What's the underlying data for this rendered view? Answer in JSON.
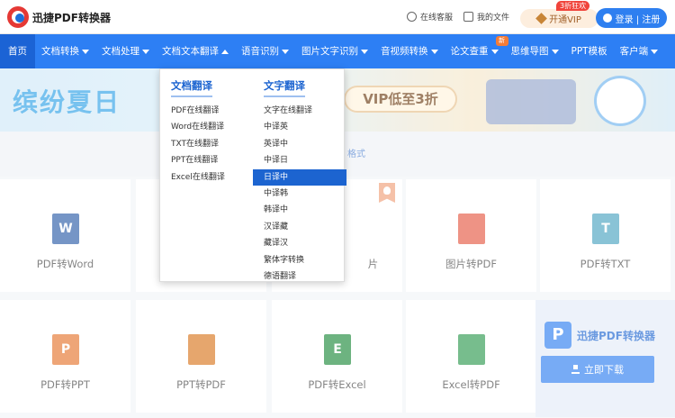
{
  "header": {
    "brand": "迅捷PDF转换器",
    "service": "在线客服",
    "my_files": "我的文件",
    "vip_button": "开通VIP",
    "vip_tag": "3折狂欢",
    "login": "登录 | 注册"
  },
  "nav": {
    "items": [
      {
        "label": "首页"
      },
      {
        "label": "文档转换"
      },
      {
        "label": "文档处理"
      },
      {
        "label": "文档文本翻译"
      },
      {
        "label": "语音识别"
      },
      {
        "label": "图片文字识别"
      },
      {
        "label": "音视频转换"
      },
      {
        "label": "论文查重"
      },
      {
        "label": "思维导图"
      },
      {
        "label": "PPT模板"
      },
      {
        "label": "客户端"
      }
    ],
    "new_badge": "新"
  },
  "banner": {
    "title": "缤纷夏日",
    "vip": "VIP低至3折"
  },
  "strip": {
    "text": "格式"
  },
  "dropdown": {
    "col1_title": "文档翻译",
    "col1_items": [
      "PDF在线翻译",
      "Word在线翻译",
      "TXT在线翻译",
      "PPT在线翻译",
      "Excel在线翻译"
    ],
    "col2_title": "文字翻译",
    "col2_items": [
      "文字在线翻译",
      "中译英",
      "英译中",
      "中译日",
      "日译中",
      "中译韩",
      "韩译中",
      "汉译藏",
      "藏译汉",
      "繁体字转换",
      "德语翻译"
    ]
  },
  "tools": [
    {
      "label": "PDF转Word",
      "icon_letter": "W",
      "color": "#2b5ca8"
    },
    {
      "label": "片",
      "icon_letter": "",
      "color": "#ffffff"
    },
    {
      "label": "图片转PDF",
      "icon_letter": "",
      "color": "#e55a44"
    },
    {
      "label": "PDF转TXT",
      "icon_letter": "T",
      "color": "#4aa3c0"
    },
    {
      "label": "PDF转PPT",
      "icon_letter": "P",
      "color": "#e5762f"
    },
    {
      "label": "PPT转PDF",
      "icon_letter": "",
      "color": "#d97720"
    },
    {
      "label": "PDF转Excel",
      "icon_letter": "E",
      "color": "#1f8a3c"
    },
    {
      "label": "Excel转PDF",
      "icon_letter": "",
      "color": "#2f9a51"
    }
  ],
  "side_ad": {
    "name": "迅捷PDF转换器",
    "logo_letter": "P",
    "button": "立即下载"
  }
}
